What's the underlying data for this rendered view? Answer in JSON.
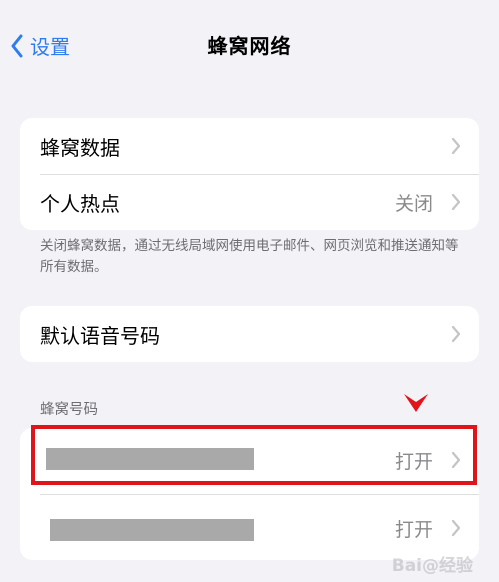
{
  "nav": {
    "back_label": "设置",
    "title": "蜂窝网络"
  },
  "group1": {
    "items": [
      {
        "label": "蜂窝数据",
        "value": ""
      },
      {
        "label": "个人热点",
        "value": "关闭"
      }
    ],
    "footnote": "关闭蜂窝数据，通过无线局域网使用电子邮件、网页浏览和推送通知等所有数据。"
  },
  "group2": {
    "items": [
      {
        "label": "默认语音号码"
      }
    ]
  },
  "group3": {
    "header": "蜂窝号码",
    "items": [
      {
        "value": "打开"
      },
      {
        "value": "打开"
      }
    ]
  },
  "watermark": "Bai@经验",
  "colors": {
    "accent": "#2f7bf0",
    "highlight": "#e0151b",
    "background": "#f2f2f7"
  }
}
